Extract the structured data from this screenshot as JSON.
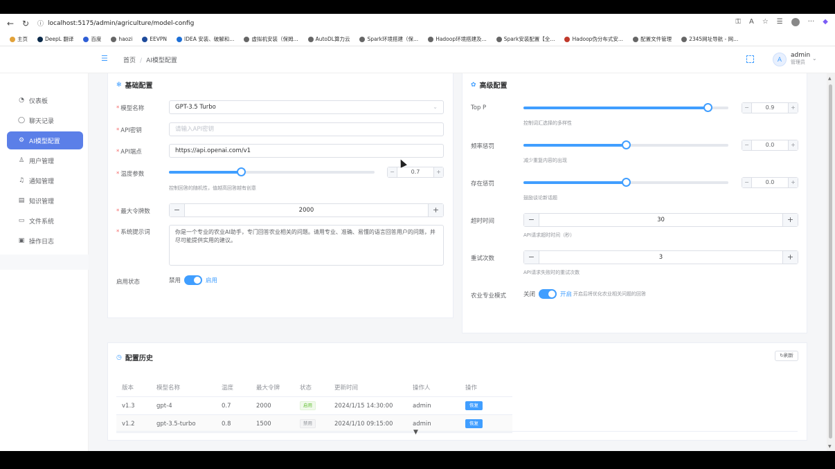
{
  "browser": {
    "url": "localhost:5175/admin/agriculture/model-config",
    "bookmarks": [
      "主页",
      "DeepL 翻译",
      "百度",
      "haozi",
      "EEVPN",
      "IDEA 安装、破解和...",
      "虚拟机安装（保姆...",
      "AutoDL算力云",
      "Spark环境搭建（保...",
      "Hadoop环境搭建及...",
      "Spark安装配置【全...",
      "Hadoop伪分布式安...",
      "配置文件管理",
      "2345网址导航 - 网..."
    ]
  },
  "header": {
    "breadcrumb_home": "首页",
    "breadcrumb_sep": "/",
    "breadcrumb_current": "AI模型配置",
    "avatar_letter": "A",
    "username": "admin",
    "role": "管理员"
  },
  "sidebar": {
    "items": [
      {
        "label": "仪表板",
        "icon": "dashboard-icon"
      },
      {
        "label": "聊天记录",
        "icon": "chat-icon"
      },
      {
        "label": "AI模型配置",
        "icon": "gear-icon"
      },
      {
        "label": "用户管理",
        "icon": "user-icon"
      },
      {
        "label": "通知管理",
        "icon": "bell-icon"
      },
      {
        "label": "知识管理",
        "icon": "document-icon"
      },
      {
        "label": "文件系统",
        "icon": "folder-icon"
      },
      {
        "label": "操作日志",
        "icon": "log-icon"
      }
    ]
  },
  "basic": {
    "title": "基础配置",
    "model_label": "模型名称",
    "model_value": "GPT-3.5 Turbo",
    "apikey_label": "API密钥",
    "apikey_placeholder": "请输入API密钥",
    "endpoint_label": "API端点",
    "endpoint_value": "https://api.openai.com/v1",
    "temp_label": "温度参数",
    "temp_value": "0.7",
    "temp_fraction": 0.35,
    "temp_hint": "控制回答的随机性，值越高回答越有创意",
    "maxtokens_label": "最大令牌数",
    "maxtokens_value": "2000",
    "prompt_label": "系统提示词",
    "prompt_value": "你是一个专业的农业AI助手，专门回答农业相关的问题。请用专业、准确、易懂的语言回答用户的问题，并尽可能提供实用的建议。",
    "status_label": "启用状态",
    "status_off": "禁用",
    "status_on": "启用"
  },
  "advanced": {
    "title": "高级配置",
    "topp_label": "Top P",
    "topp_value": "0.9",
    "topp_fraction": 0.9,
    "topp_hint": "控制词汇选择的多样性",
    "freq_label": "频率惩罚",
    "freq_value": "0.0",
    "freq_fraction": 0.5,
    "freq_hint": "减少重复内容的出现",
    "presence_label": "存在惩罚",
    "presence_value": "0.0",
    "presence_fraction": 0.5,
    "presence_hint": "鼓励谈论新话题",
    "timeout_label": "超时时间",
    "timeout_value": "30",
    "timeout_hint": "API请求超时时间（秒）",
    "retry_label": "重试次数",
    "retry_value": "3",
    "retry_hint": "API请求失败时的重试次数",
    "agri_label": "农业专业模式",
    "agri_off": "关闭",
    "agri_on": "开启",
    "agri_hint": "开启后将优化农业相关问题的回答"
  },
  "history": {
    "title": "配置历史",
    "refresh": "刷新",
    "columns": [
      "版本",
      "模型名称",
      "温度",
      "最大令牌",
      "状态",
      "更新时间",
      "操作人",
      "操作"
    ],
    "rows": [
      {
        "version": "v1.3",
        "model": "gpt-4",
        "temp": "0.7",
        "tokens": "2000",
        "status": "启用",
        "time": "2024/1/15 14:30:00",
        "operator": "admin",
        "action": "恢复"
      },
      {
        "version": "v1.2",
        "model": "gpt-3.5-turbo",
        "temp": "0.8",
        "tokens": "1500",
        "status": "禁用",
        "time": "2024/1/10 09:15:00",
        "operator": "admin",
        "action": "恢复"
      }
    ]
  },
  "colors": {
    "accent": "#409eff",
    "active_nav": "#5b7fe8",
    "required": "#f56c6c"
  }
}
